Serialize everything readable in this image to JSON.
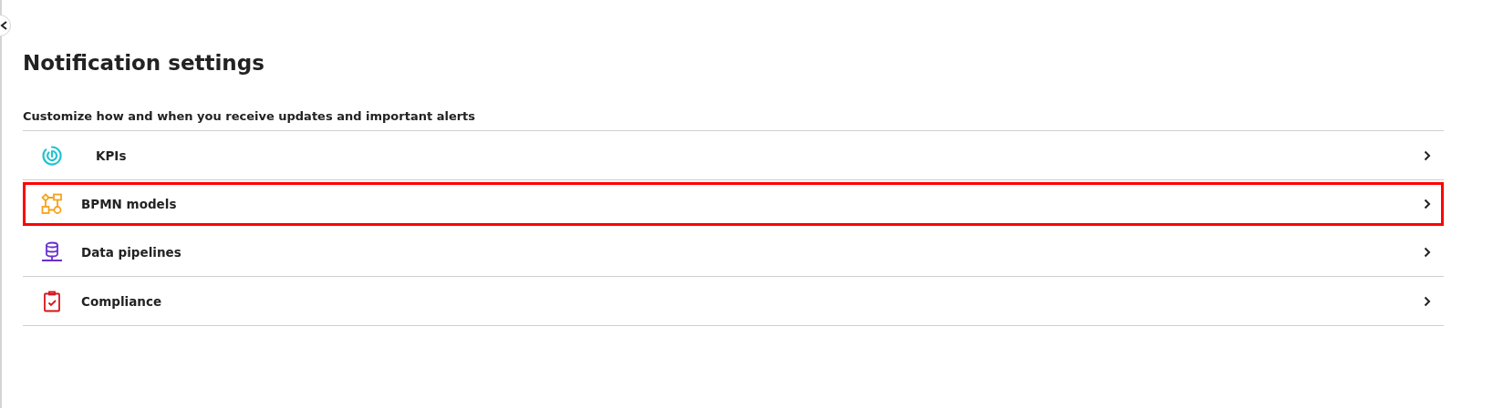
{
  "title": "Notification settings",
  "subtitle": "Customize how and when you receive updates and important alerts",
  "items": [
    {
      "label": "KPIs",
      "kind": "kpi",
      "selected": false
    },
    {
      "label": "BPMN models",
      "kind": "bpmn",
      "selected": true
    },
    {
      "label": "Data pipelines",
      "kind": "pipeline",
      "selected": false
    },
    {
      "label": "Compliance",
      "kind": "compliance",
      "selected": false
    }
  ]
}
